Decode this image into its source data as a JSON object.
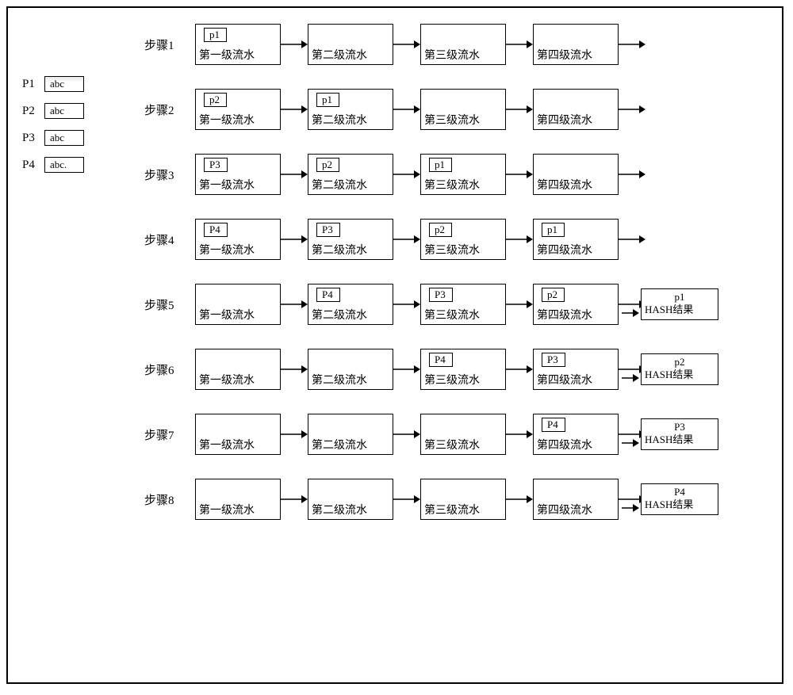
{
  "legend": {
    "items": [
      {
        "label": "P1",
        "content": "abc"
      },
      {
        "label": "P2",
        "content": "abc"
      },
      {
        "label": "P3",
        "content": "abc"
      },
      {
        "label": "P4",
        "content": "abc."
      }
    ]
  },
  "stages": {
    "s1": "第一级流水",
    "s2": "第二级流水",
    "s3": "第三级流水",
    "s4": "第四级流水"
  },
  "steps": [
    {
      "label": "步骤1",
      "packets": [
        "p1",
        "",
        "",
        ""
      ],
      "result": null
    },
    {
      "label": "步骤2",
      "packets": [
        "p2",
        "p1",
        "",
        ""
      ],
      "result": null
    },
    {
      "label": "步骤3",
      "packets": [
        "P3",
        "p2",
        "p1",
        ""
      ],
      "result": null
    },
    {
      "label": "步骤4",
      "packets": [
        "P4",
        "P3",
        "p2",
        "p1"
      ],
      "result": null
    },
    {
      "label": "步骤5",
      "packets": [
        "",
        "P4",
        "P3",
        "p2"
      ],
      "result": {
        "pkt": "p1",
        "text": "HASH结果"
      }
    },
    {
      "label": "步骤6",
      "packets": [
        "",
        "",
        "P4",
        "P3"
      ],
      "result": {
        "pkt": "p2",
        "text": "HASH结果"
      }
    },
    {
      "label": "步骤7",
      "packets": [
        "",
        "",
        "",
        "P4"
      ],
      "result": {
        "pkt": "P3",
        "text": "HASH结果"
      }
    },
    {
      "label": "步骤8",
      "packets": [
        "",
        "",
        "",
        ""
      ],
      "result": {
        "pkt": "P4",
        "text": "HASH结果"
      }
    }
  ]
}
